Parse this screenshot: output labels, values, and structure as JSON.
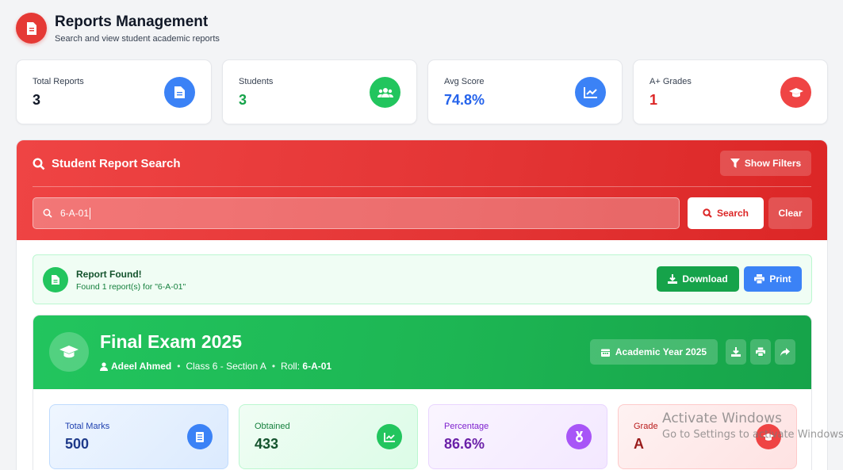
{
  "header": {
    "title": "Reports Management",
    "subtitle": "Search and view student academic reports"
  },
  "stats": [
    {
      "label": "Total Reports",
      "value": "3",
      "color": "#111827",
      "icon": "document-icon",
      "icon_bg": "#3b82f6"
    },
    {
      "label": "Students",
      "value": "3",
      "color": "#16a34a",
      "icon": "users-icon",
      "icon_bg": "#22c55e"
    },
    {
      "label": "Avg Score",
      "value": "74.8%",
      "color": "#2563eb",
      "icon": "chart-line-icon",
      "icon_bg": "#3b82f6"
    },
    {
      "label": "A+ Grades",
      "value": "1",
      "color": "#dc2626",
      "icon": "graduation-cap-icon",
      "icon_bg": "#ef4444"
    }
  ],
  "search": {
    "title": "Student Report Search",
    "filters_label": "Show Filters",
    "query": "6-A-01",
    "search_label": "Search",
    "clear_label": "Clear"
  },
  "result": {
    "title": "Report Found!",
    "message": "Found 1 report(s) for \"6-A-01\"",
    "download_label": "Download",
    "print_label": "Print"
  },
  "report": {
    "title": "Final Exam 2025",
    "student": "Adeel Ahmed",
    "class": "Class 6 - Section A",
    "roll_label": "Roll:",
    "roll": "6-A-01",
    "year_label": "Academic Year 2025",
    "cards": [
      {
        "label": "Total Marks",
        "value": "500",
        "icon": "book-icon"
      },
      {
        "label": "Obtained",
        "value": "433",
        "icon": "chart-line-icon"
      },
      {
        "label": "Percentage",
        "value": "86.6%",
        "icon": "medal-icon"
      },
      {
        "label": "Grade",
        "value": "A",
        "icon": "graduation-cap-icon"
      }
    ]
  },
  "watermark": {
    "line1": "Activate Windows",
    "line2": "Go to Settings to activate Windows."
  },
  "colors": {
    "brand_red": "#e53935",
    "success_green": "#22c55e",
    "primary_blue": "#3b82f6",
    "purple": "#a855f7"
  }
}
